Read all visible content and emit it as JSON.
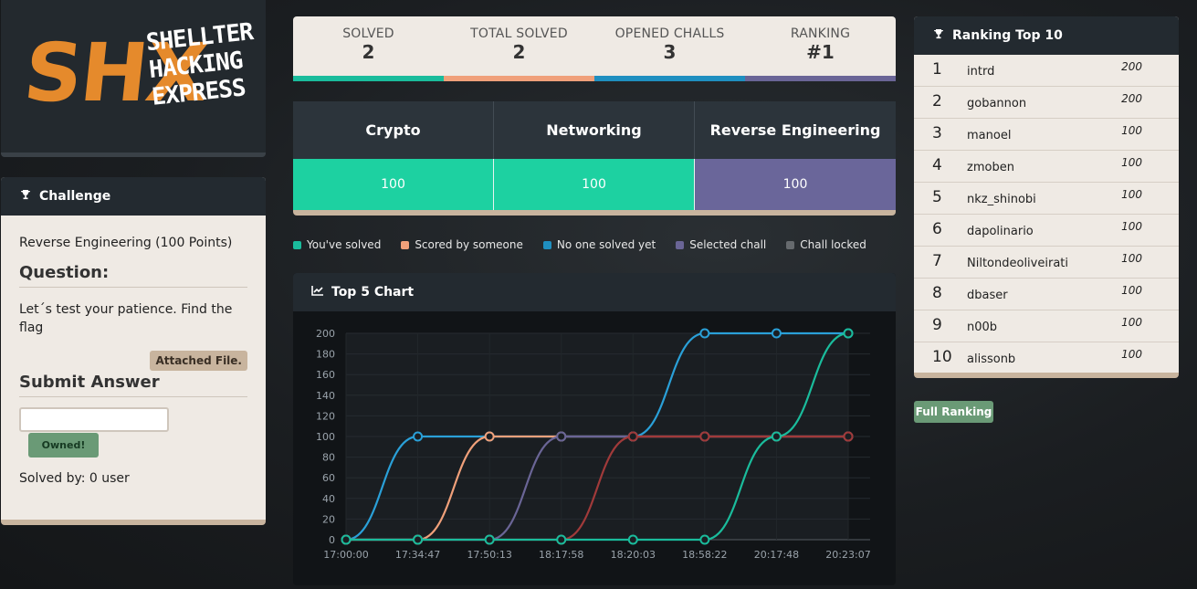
{
  "logo": {
    "big": "SHX",
    "line1": "SHELLTER",
    "line2": "HACKING",
    "line3": "EXPRESS"
  },
  "challenge": {
    "header": "Challenge",
    "title": "Reverse Engineering (100 Points)",
    "question_heading": "Question:",
    "question_text": "Let´s test your patience. Find the flag",
    "attached_label": "Attached File.",
    "submit_heading": "Submit Answer",
    "answer_value": "",
    "owned_label": "Owned!",
    "solved_by": "Solved by: 0 user"
  },
  "stats": [
    {
      "label": "SOLVED",
      "value": "2",
      "color": "#1abc9c"
    },
    {
      "label": "TOTAL SOLVED",
      "value": "2",
      "color": "#f0a07a"
    },
    {
      "label": "OPENED CHALLS",
      "value": "3",
      "color": "#1f8fc0"
    },
    {
      "label": "RANKING",
      "value": "#1",
      "color": "#6a6596"
    }
  ],
  "categories": [
    {
      "name": "Crypto",
      "points": "100",
      "color": "#1dd1a1"
    },
    {
      "name": "Networking",
      "points": "100",
      "color": "#1dd1a1"
    },
    {
      "name": "Reverse Engineering",
      "points": "100",
      "color": "#6a669a"
    }
  ],
  "legend": [
    {
      "label": "You've solved",
      "color": "#1abc9c"
    },
    {
      "label": "Scored by someone",
      "color": "#f0a07a"
    },
    {
      "label": "No one solved yet",
      "color": "#1f8fc0"
    },
    {
      "label": "Selected chall",
      "color": "#6a6596"
    },
    {
      "label": "Chall locked",
      "color": "#666a6e"
    }
  ],
  "chart": {
    "header": "Top 5 Chart"
  },
  "chart_data": {
    "type": "line",
    "title": "",
    "x": [
      "17:00:00",
      "17:34:47",
      "17:50:13",
      "18:17:58",
      "18:20:03",
      "18:58:22",
      "20:17:48",
      "20:23:07"
    ],
    "yticks": [
      0,
      20,
      40,
      60,
      80,
      100,
      120,
      140,
      160,
      180,
      200
    ],
    "ylim": [
      0,
      200
    ],
    "grid": true,
    "series": [
      {
        "color": "#2aa0d8",
        "values": [
          0,
          100,
          100,
          100,
          100,
          200,
          200,
          200
        ]
      },
      {
        "color": "#f0a07a",
        "values": [
          0,
          0,
          100,
          100,
          100,
          100,
          100,
          100
        ]
      },
      {
        "color": "#6a6596",
        "values": [
          0,
          0,
          0,
          100,
          100,
          100,
          100,
          100
        ]
      },
      {
        "color": "#a03a3a",
        "values": [
          0,
          0,
          0,
          0,
          100,
          100,
          100,
          100
        ]
      },
      {
        "color": "#1abc9c",
        "values": [
          0,
          0,
          0,
          0,
          0,
          0,
          100,
          200
        ]
      }
    ]
  },
  "ranking": {
    "header": "Ranking Top 10",
    "rows": [
      {
        "rank": "1",
        "name": "intrd",
        "points": "200"
      },
      {
        "rank": "2",
        "name": "gobannon",
        "points": "200"
      },
      {
        "rank": "3",
        "name": "manoel",
        "points": "100"
      },
      {
        "rank": "4",
        "name": "zmoben",
        "points": "100"
      },
      {
        "rank": "5",
        "name": "nkz_shinobi",
        "points": "100"
      },
      {
        "rank": "6",
        "name": "dapolinario",
        "points": "100"
      },
      {
        "rank": "7",
        "name": "Niltondeoliveirati",
        "points": "100"
      },
      {
        "rank": "8",
        "name": "dbaser",
        "points": "100"
      },
      {
        "rank": "9",
        "name": "n00b",
        "points": "100"
      },
      {
        "rank": "10",
        "name": "alissonb",
        "points": "100"
      }
    ],
    "full_label": "Full Ranking"
  }
}
